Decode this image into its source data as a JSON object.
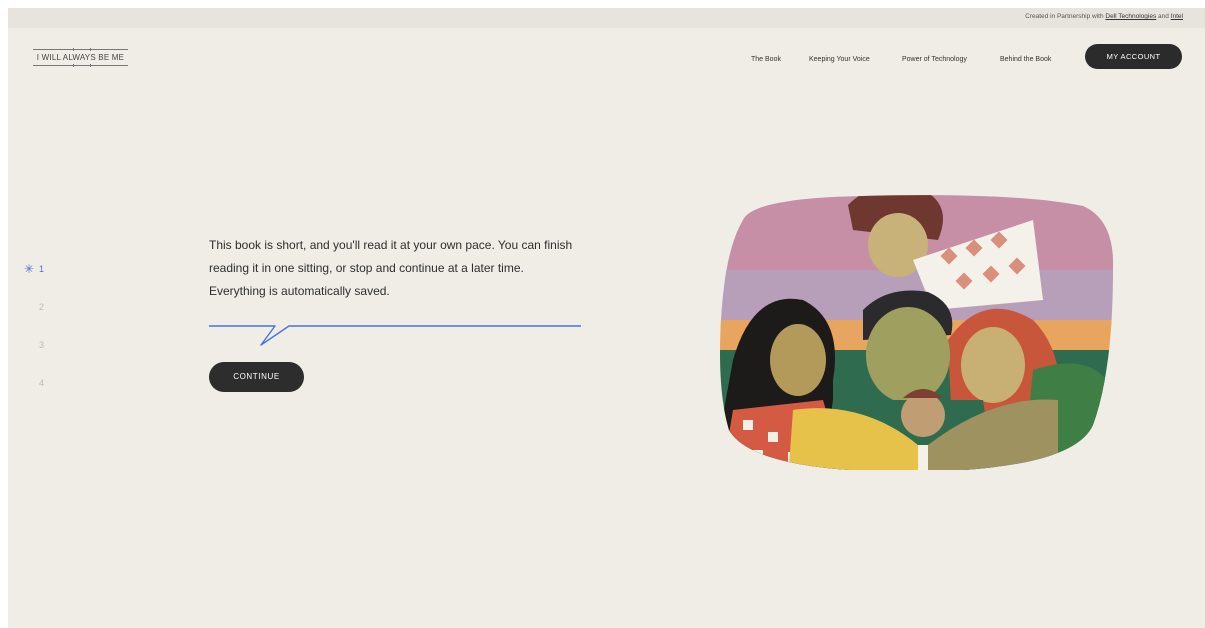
{
  "topbar": {
    "partner_prefix": "Created in Partnership with",
    "partner_dell": "Dell Technologies",
    "partner_and": "and",
    "partner_intel": "Intel"
  },
  "header": {
    "logo_text": "I WILL ALWAYS BE ME",
    "nav": [
      "The Book",
      "Keeping Your Voice",
      "Power of Technology",
      "Behind the Book"
    ],
    "account_label": "MY ACCOUNT"
  },
  "steps": {
    "active_marker": "✳",
    "items": [
      "1",
      "2",
      "3",
      "4"
    ],
    "active_index": 0
  },
  "main": {
    "body": "This book is short, and you'll read it at your own pace. You can finish reading it in one sitting, or stop and continue at a later time. Everything is automatically saved.",
    "continue_label": "CONTINUE"
  },
  "colors": {
    "accent_blue": "#4a73d8",
    "button_dark": "#2b2b2b",
    "background": "#efede6"
  },
  "illustration": {
    "icon": "family-reading-book-illustration"
  }
}
